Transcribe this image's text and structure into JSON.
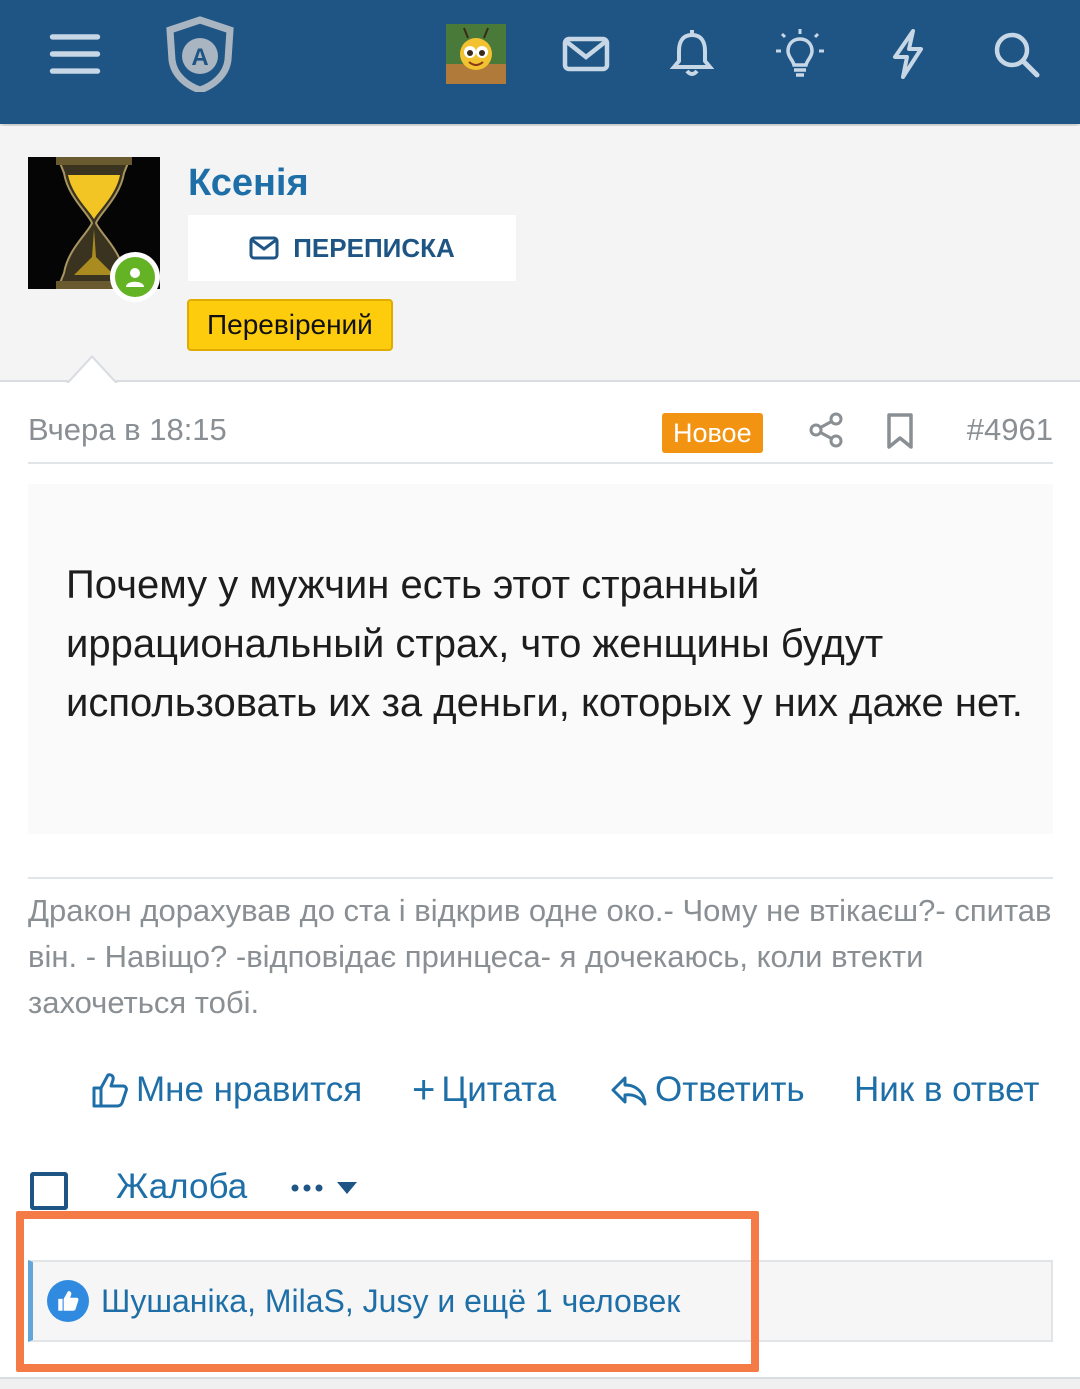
{
  "header": {
    "menu_icon": "hamburger-icon",
    "logo_icon": "shield-a-logo",
    "icons": [
      "user-avatar",
      "mail-icon",
      "bell-icon",
      "lightbulb-icon",
      "lightning-icon",
      "search-icon"
    ]
  },
  "profile": {
    "username": "Ксенія",
    "message_button": "ПЕРЕПИСКА",
    "badge": "Перевірений",
    "status": "online"
  },
  "post": {
    "date": "Вчера в 18:15",
    "new_label": "Новое",
    "number": "#4961",
    "quote_text": "Почему у мужчин есть этот странный иррациональный страх, что женщины будут использовать их за деньги, которых у них даже нет.",
    "signature": "Дракон дорахував до ста і відкрив одне око.- Чому не втікаєш?- спитав він. - Навіщо? -відповідає принцеса- я дочекаюсь, коли втекти захочеться тобі."
  },
  "actions": {
    "like": "Мне нравится",
    "quote": "Цитата",
    "reply": "Ответить",
    "mention": "Ник в ответ",
    "report": "Жалоба"
  },
  "likes": {
    "text": "Шушаніка, MilaS, Jusy и ещё 1 человек"
  },
  "colors": {
    "header_bg": "#1e5585",
    "link": "#1e6fa8",
    "new_badge": "#f29412",
    "verified_badge": "#fdcc0d",
    "highlight": "#f57b46",
    "online": "#63b324"
  }
}
